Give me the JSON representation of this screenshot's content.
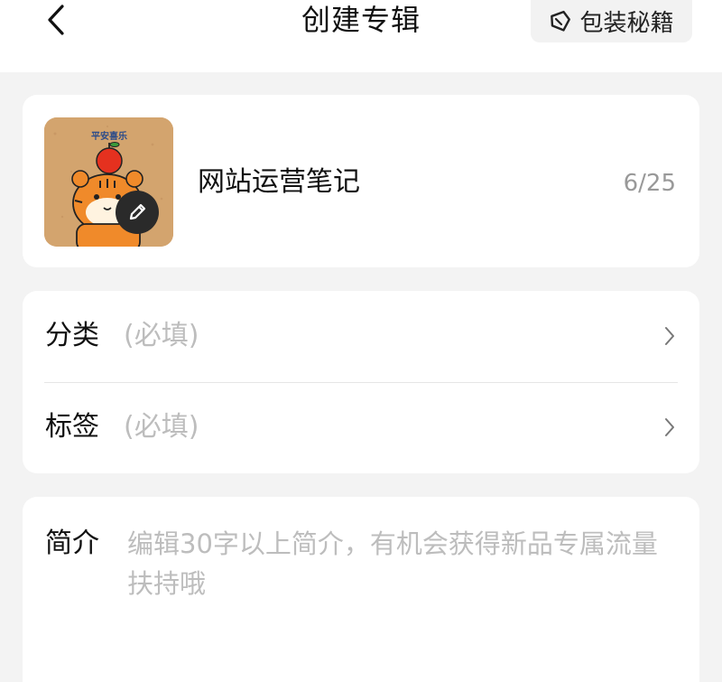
{
  "header": {
    "title": "创建专辑",
    "tips_label": "包装秘籍",
    "back_icon": "chevron-left-icon",
    "tips_icon": "tag-icon"
  },
  "cover_card": {
    "cover_caption": "平安喜乐",
    "edit_icon": "pencil-icon",
    "album_name": "网站运营笔记",
    "char_counter": "6/25"
  },
  "fields": [
    {
      "label": "分类",
      "placeholder": "(必填)"
    },
    {
      "label": "标签",
      "placeholder": "(必填)"
    }
  ],
  "intro": {
    "label": "简介",
    "placeholder": "编辑30字以上简介，有机会获得新品专属流量扶持哦"
  },
  "colors": {
    "background": "#f3f3f3",
    "card": "#ffffff",
    "placeholder": "#bdbdbd",
    "counter": "#999999"
  }
}
